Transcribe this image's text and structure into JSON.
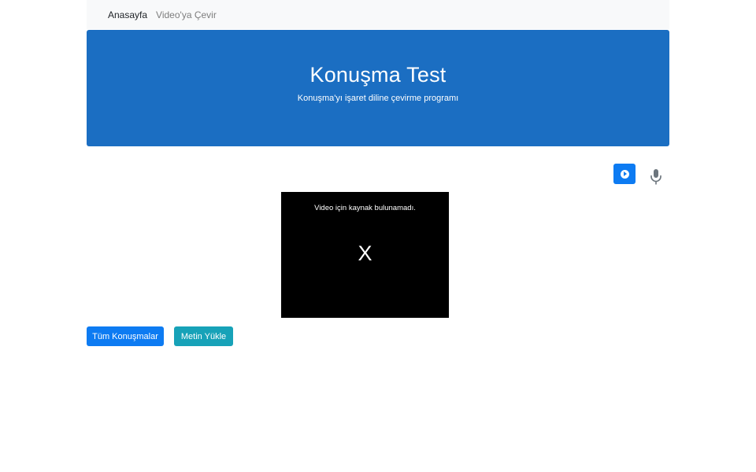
{
  "nav": {
    "items": [
      {
        "label": "Anasayfa",
        "active": true
      },
      {
        "label": "Video'ya Çevir",
        "active": false
      }
    ]
  },
  "header": {
    "title": "Konuşma Test",
    "subtitle": "Konuşma'yı işaret diline çevirme programı"
  },
  "controls": {
    "play_icon": "play-circle-icon",
    "mic_icon": "microphone-icon"
  },
  "video": {
    "message": "Video için kaynak bulunamadı.",
    "close_glyph": "X"
  },
  "actions": {
    "all_conversations_label": "Tüm Konuşmalar",
    "upload_text_label": "Metin Yükle"
  },
  "colors": {
    "header_bg": "#1b6ec2",
    "primary": "#0d7bf2",
    "info": "#17a2b8",
    "navbar_bg": "#f8f9fa"
  }
}
